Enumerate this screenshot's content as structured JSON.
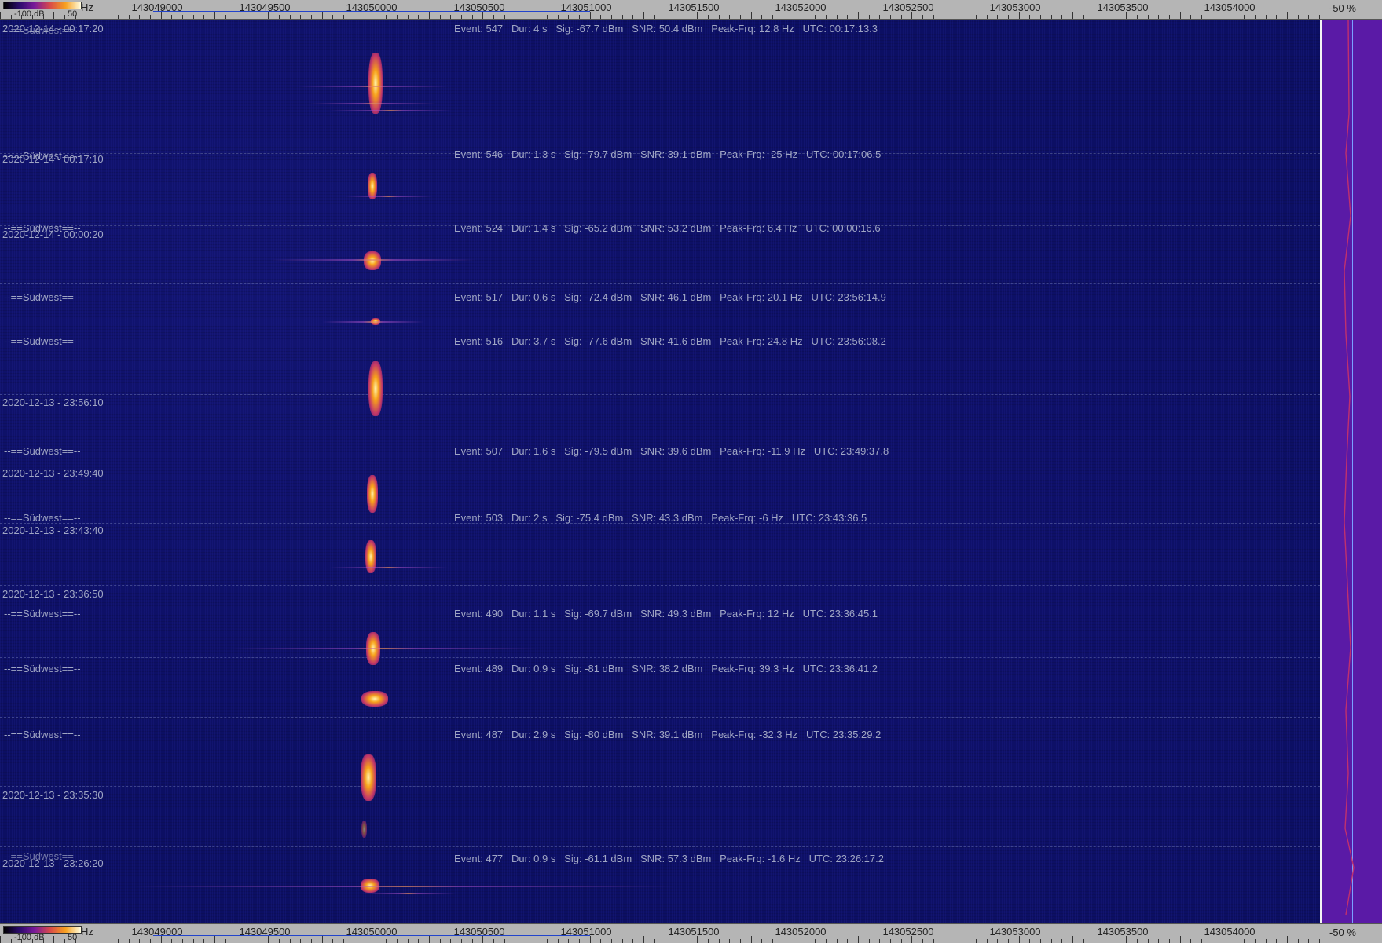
{
  "scale": {
    "db_left": "-100 dB",
    "db_right": "50",
    "unit": "Hz",
    "frequencies": [
      "143049000",
      "143049500",
      "143050000",
      "143050500",
      "143051000",
      "143051500",
      "143052000",
      "143052500",
      "143053000",
      "143053500",
      "143054000"
    ],
    "percent": "-50 %"
  },
  "rows": [
    {
      "timestamp": "2020-12-14 - 00:17:20",
      "location": "--==Südwest==--",
      "event": "Event: 547   Dur: 4 s   Sig: -67.7 dBm   SNR: 50.4 dBm   Peak-Frq: 12.8 Hz   UTC: 00:17:13.3"
    },
    {
      "timestamp": "2020-12-14 - 00:17:10",
      "location": "--==Südwest==--",
      "event": "Event: 546   Dur: 1.3 s   Sig: -79.7 dBm   SNR: 39.1 dBm   Peak-Frq: -25 Hz   UTC: 00:17:06.5"
    },
    {
      "timestamp": "2020-12-14 - 00:00:20",
      "location": "--==Südwest==--",
      "event": "Event: 524   Dur: 1.4 s   Sig: -65.2 dBm   SNR: 53.2 dBm   Peak-Frq: 6.4 Hz   UTC: 00:00:16.6"
    },
    {
      "timestamp": "",
      "location": "--==Südwest==--",
      "event": "Event: 517   Dur: 0.6 s   Sig: -72.4 dBm   SNR: 46.1 dBm   Peak-Frq: 20.1 Hz   UTC: 23:56:14.9"
    },
    {
      "timestamp": "",
      "location": "--==Südwest==--",
      "event": "Event: 516   Dur: 3.7 s   Sig: -77.6 dBm   SNR: 41.6 dBm   Peak-Frq: 24.8 Hz   UTC: 23:56:08.2"
    },
    {
      "timestamp": "2020-12-13 - 23:56:10",
      "location": "",
      "event": ""
    },
    {
      "timestamp": "",
      "location": "--==Südwest==--",
      "event": "Event: 507   Dur: 1.6 s   Sig: -79.5 dBm   SNR: 39.6 dBm   Peak-Frq: -11.9 Hz   UTC: 23:49:37.8"
    },
    {
      "timestamp": "2020-12-13 - 23:49:40",
      "location": "",
      "event": ""
    },
    {
      "timestamp": "",
      "location": "--==Südwest==--",
      "event": "Event: 503   Dur: 2 s   Sig: -75.4 dBm   SNR: 43.3 dBm   Peak-Frq: -6 Hz   UTC: 23:43:36.5"
    },
    {
      "timestamp": "2020-12-13 - 23:43:40",
      "location": "",
      "event": ""
    },
    {
      "timestamp": "2020-12-13 - 23:36:50",
      "location": "",
      "event": ""
    },
    {
      "timestamp": "",
      "location": "--==Südwest==--",
      "event": "Event: 490   Dur: 1.1 s   Sig: -69.7 dBm   SNR: 49.3 dBm   Peak-Frq: 12 Hz   UTC: 23:36:45.1"
    },
    {
      "timestamp": "",
      "location": "--==Südwest==--",
      "event": "Event: 489   Dur: 0.9 s   Sig: -81 dBm   SNR: 38.2 dBm   Peak-Frq: 39.3 Hz   UTC: 23:36:41.2"
    },
    {
      "timestamp": "",
      "location": "--==Südwest==--",
      "event": "Event: 487   Dur: 2.9 s   Sig: -80 dBm   SNR: 39.1 dBm   Peak-Frq: -32.3 Hz   UTC: 23:35:29.2"
    },
    {
      "timestamp": "2020-12-13 - 23:35:30",
      "location": "",
      "event": ""
    },
    {
      "timestamp": "2020-12-13 - 23:26:20",
      "location": "--==Südwest==--",
      "event": "Event: 477   Dur: 0.9 s   Sig: -61.1 dBm   SNR: 57.3 dBm   Peak-Frq: -1.6 Hz   UTC: 23:26:17.2"
    }
  ]
}
